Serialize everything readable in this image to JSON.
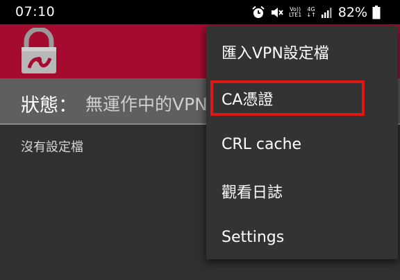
{
  "status_bar": {
    "time": "07:10",
    "volte_top": "Vo))",
    "volte_bottom": "LTE1",
    "network_top": "4G",
    "network_bottom": "↓↑",
    "battery": "82%"
  },
  "app": {
    "brand_color": "#a50b2e",
    "logo_icon": "openvpn-lock-logo"
  },
  "state": {
    "label": "狀態：",
    "value": "無運作中的VPN"
  },
  "main": {
    "empty_text": "沒有設定檔"
  },
  "menu": {
    "items": [
      {
        "label": "匯入VPN設定檔"
      },
      {
        "label": "CA憑證"
      },
      {
        "label": "CRL cache"
      },
      {
        "label": "觀看日誌"
      },
      {
        "label": "Settings"
      }
    ],
    "highlight_color": "#e01717"
  }
}
